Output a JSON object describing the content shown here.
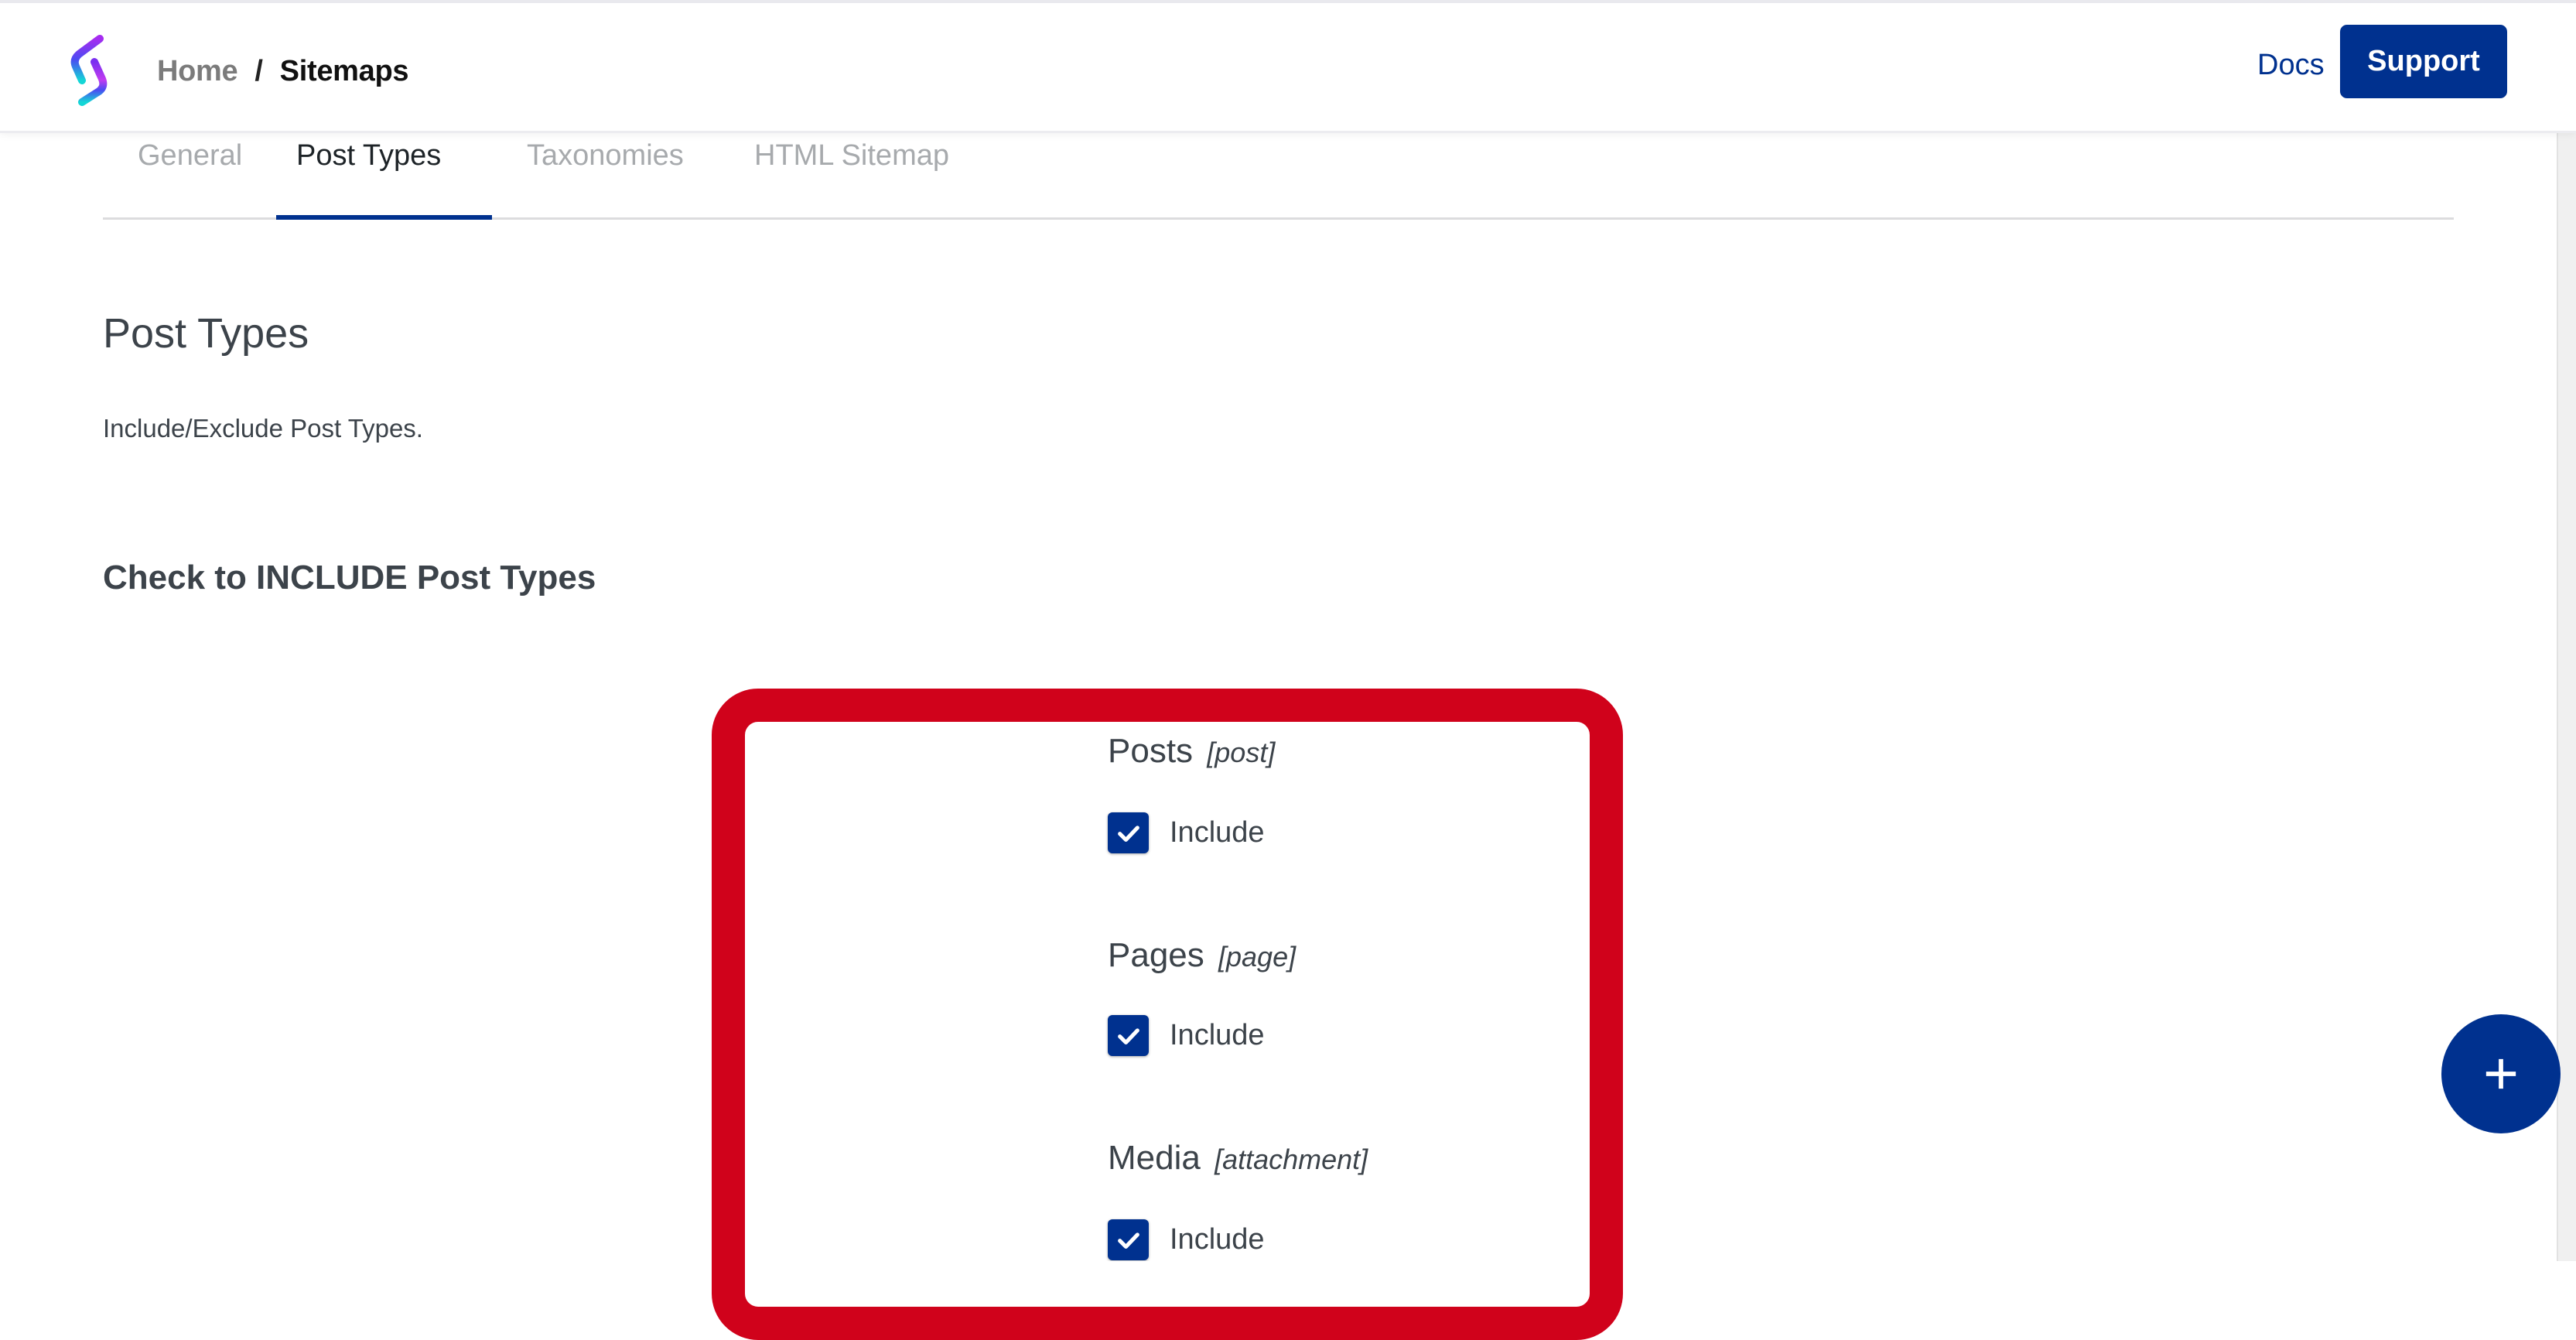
{
  "header": {
    "logo_icon": "sitemap-plugin-logo",
    "breadcrumb": {
      "home": "Home",
      "separator": "/",
      "current": "Sitemaps"
    },
    "docs_label": "Docs",
    "support_label": "Support"
  },
  "tabs": [
    {
      "label": "General",
      "active": false
    },
    {
      "label": "Post Types",
      "active": true
    },
    {
      "label": "Taxonomies",
      "active": false
    },
    {
      "label": "HTML Sitemap",
      "active": false
    }
  ],
  "page": {
    "title": "Post Types",
    "description": "Include/Exclude Post Types.",
    "section_heading": "Check to INCLUDE Post Types"
  },
  "post_types": [
    {
      "name": "Posts",
      "slug": "[post]",
      "checkbox_label": "Include",
      "checked": true
    },
    {
      "name": "Pages",
      "slug": "[page]",
      "checkbox_label": "Include",
      "checked": true
    },
    {
      "name": "Media",
      "slug": "[attachment]",
      "checkbox_label": "Include",
      "checked": true
    }
  ],
  "fab": {
    "icon": "plus-icon"
  },
  "colors": {
    "brand": "#00318f",
    "highlight": "#d0021b",
    "text": "#3c434a",
    "tab_inactive": "#a7aaad"
  }
}
